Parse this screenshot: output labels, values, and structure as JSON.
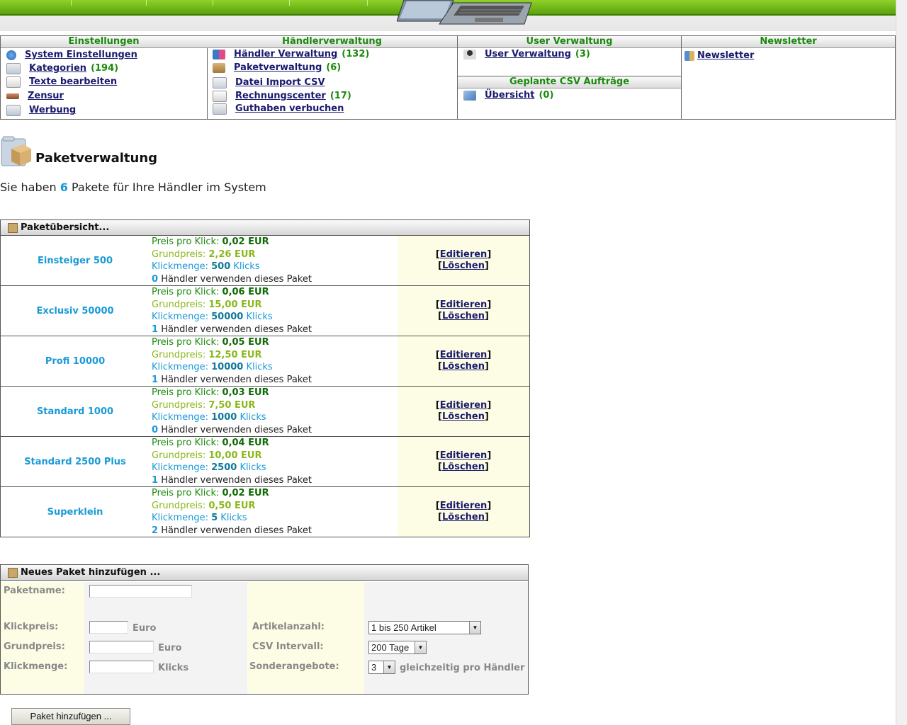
{
  "menu": {
    "einstellungen": {
      "title": "Einstellungen",
      "items": [
        {
          "label": "System Einstellungen",
          "count": ""
        },
        {
          "label": "Kategorien",
          "count": "(194)"
        },
        {
          "label": "Texte bearbeiten",
          "count": ""
        },
        {
          "label": "Zensur",
          "count": ""
        },
        {
          "label": "Werbung",
          "count": ""
        }
      ]
    },
    "haendler": {
      "title": "Händlerverwaltung",
      "items": [
        {
          "label": "Händler Verwaltung",
          "count": "(132)"
        },
        {
          "label": "Paketverwaltung",
          "count": "(6)"
        },
        {
          "label": "Datei Import CSV",
          "count": ""
        },
        {
          "label": "Rechnungscenter",
          "count": "(17)"
        },
        {
          "label": "Guthaben verbuchen",
          "count": ""
        }
      ]
    },
    "user": {
      "title": "User Verwaltung",
      "item": {
        "label": "User Verwaltung",
        "count": "(3)"
      }
    },
    "csv": {
      "title": "Geplante CSV Aufträge",
      "item": {
        "label": "Übersicht",
        "count": "(0)"
      }
    },
    "newsletter": {
      "title": "Newsletter",
      "item": {
        "label": "Newsletter"
      }
    }
  },
  "page": {
    "title": "Paketverwaltung",
    "intro_before": "Sie haben",
    "intro_count": "6",
    "intro_after": "Pakete für Ihre Händler im System"
  },
  "packages": {
    "header": "Paketübersicht...",
    "labels": {
      "price_per_click": "Preis pro Klick:",
      "base_price": "Grundpreis:",
      "click_amount": "Klickmenge:",
      "clicks": "Klicks",
      "dealers_use": "Händler verwenden dieses Paket",
      "edit": "Editieren",
      "delete": "Löschen"
    },
    "rows": [
      {
        "name": "Einsteiger 500",
        "ppc": "0,02 EUR",
        "base": "2,26 EUR",
        "clicks": "500",
        "dealers": "0"
      },
      {
        "name": "Exclusiv 50000",
        "ppc": "0,06 EUR",
        "base": "15,00 EUR",
        "clicks": "50000",
        "dealers": "1"
      },
      {
        "name": "Profi 10000",
        "ppc": "0,05 EUR",
        "base": "12,50 EUR",
        "clicks": "10000",
        "dealers": "1"
      },
      {
        "name": "Standard 1000",
        "ppc": "0,03 EUR",
        "base": "7,50 EUR",
        "clicks": "1000",
        "dealers": "0"
      },
      {
        "name": "Standard 2500 Plus",
        "ppc": "0,04 EUR",
        "base": "10,00 EUR",
        "clicks": "2500",
        "dealers": "1"
      },
      {
        "name": "Superklein",
        "ppc": "0,02 EUR",
        "base": "0,50 EUR",
        "clicks": "5",
        "dealers": "2"
      }
    ]
  },
  "new_package": {
    "header": "Neues Paket hinzufügen ...",
    "paketname_label": "Paketname:",
    "klickpreis_label": "Klickpreis:",
    "grundpreis_label": "Grundpreis:",
    "klickmenge_label": "Klickmenge:",
    "euro": "Euro",
    "klicks": "Klicks",
    "artikelanzahl_label": "Artikelanzahl:",
    "artikelanzahl_value": "1 bis 250 Artikel",
    "csv_label": "CSV Intervall:",
    "csv_value": "200 Tage",
    "sonder_label": "Sonderangebote:",
    "sonder_value": "3",
    "sonder_suffix": "gleichzeitig pro Händler",
    "submit": "Paket hinzufügen ..."
  }
}
